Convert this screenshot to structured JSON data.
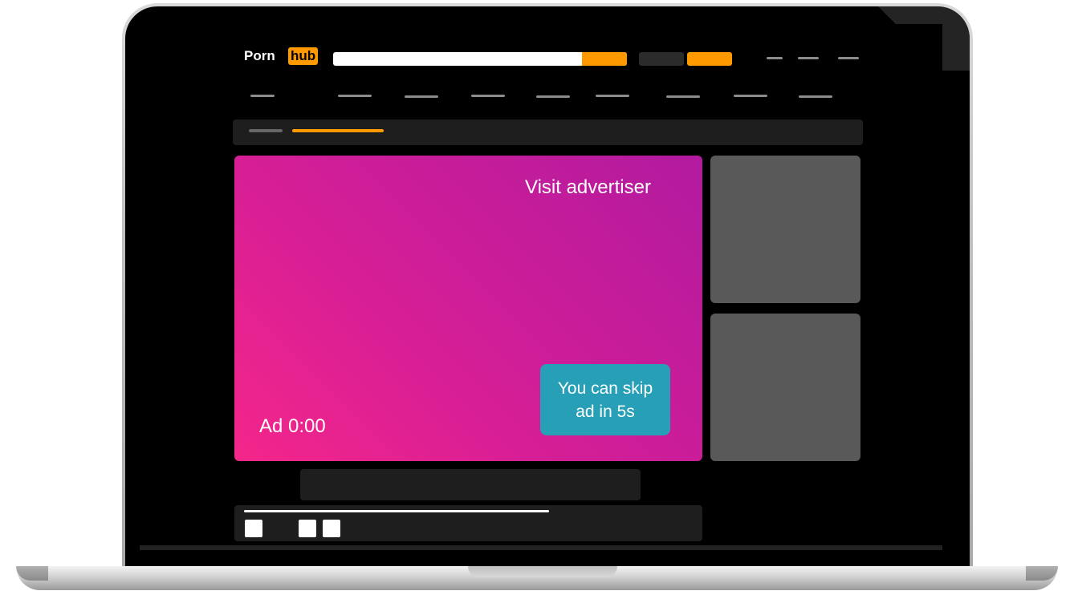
{
  "site": {
    "logo_left": "Porn",
    "logo_right": "hub"
  },
  "player": {
    "visit_label": "Visit advertiser",
    "ad_timer": "Ad 0:00",
    "skip_line1": "You can skip",
    "skip_line2": "ad in 5s"
  },
  "colors": {
    "accent": "#ff9900",
    "ad_gradient_start": "#f4268a",
    "ad_gradient_end": "#b21a9f",
    "skip_button": "#27a0b7",
    "thumbnail": "#595959"
  }
}
